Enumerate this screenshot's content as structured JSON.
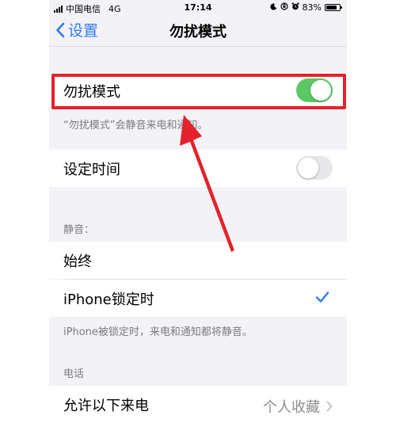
{
  "status_bar": {
    "carrier": "中国电信",
    "network": "4G",
    "time": "17:14",
    "battery": "83%",
    "battery_level": 0.83
  },
  "nav": {
    "back_label": "设置",
    "title": "勿扰模式"
  },
  "dnd": {
    "label": "勿扰模式",
    "enabled": true,
    "footnote": "“勿扰模式”会静音来电和通知。"
  },
  "scheduled": {
    "label": "设定时间",
    "enabled": false
  },
  "silence": {
    "header": "静音：",
    "options": [
      {
        "label": "始终",
        "selected": false
      },
      {
        "label": "iPhone锁定时",
        "selected": true
      }
    ],
    "footnote": "iPhone被锁定时，来电和通知都将静音。"
  },
  "phone": {
    "header": "电话",
    "allow_calls_label": "允许以下来电",
    "allow_calls_value": "个人收藏"
  },
  "colors": {
    "accent": "#2f7bf0",
    "toggle_on": "#5bc863",
    "highlight": "#e3222b"
  }
}
